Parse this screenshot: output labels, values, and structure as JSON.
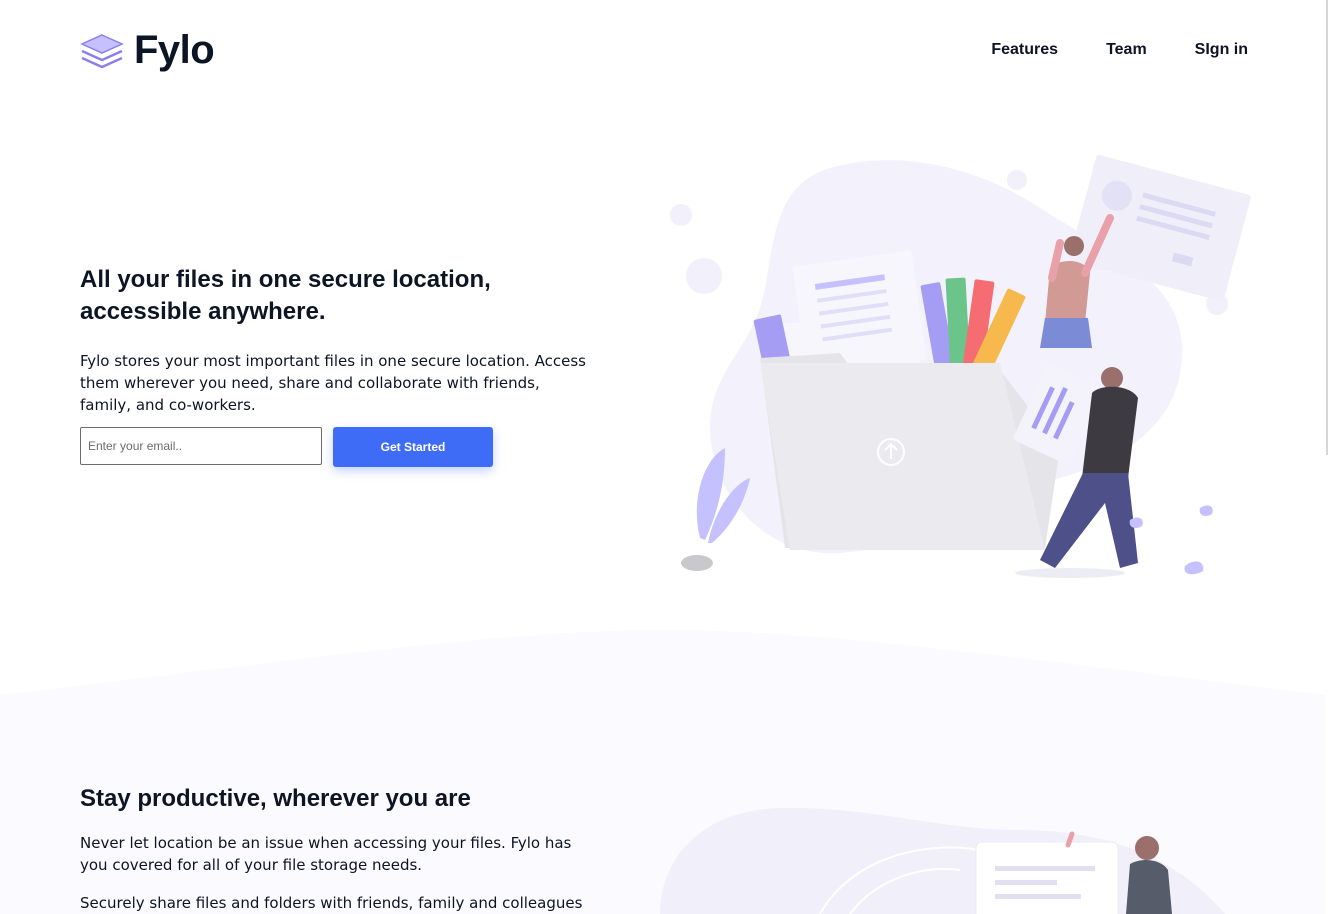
{
  "brand": {
    "name": "Fylo",
    "logo_icon": "stacked-layers-icon",
    "accent": "#3f6cf7",
    "dark": "#0c1524",
    "illustration_purple": "#c5c1ff"
  },
  "nav": {
    "items": [
      {
        "label": "Features"
      },
      {
        "label": "Team"
      },
      {
        "label": "SIgn in"
      }
    ]
  },
  "hero": {
    "title_line1": "All your files in one secure location,",
    "title_line2": "accessible anywhere.",
    "description": "Fylo stores your most important files in one secure location. Access them wherever you need, share and collaborate with friends, family, and co-workers.",
    "email_placeholder": "Enter your email..",
    "cta_label": "Get Started"
  },
  "productive": {
    "title": "Stay productive, wherever you are",
    "paragraph1": "Never let location be an issue when accessing your files. Fylo has you covered for all of your file storage needs.",
    "paragraph2": "Securely share files and folders with friends, family and colleagues"
  }
}
